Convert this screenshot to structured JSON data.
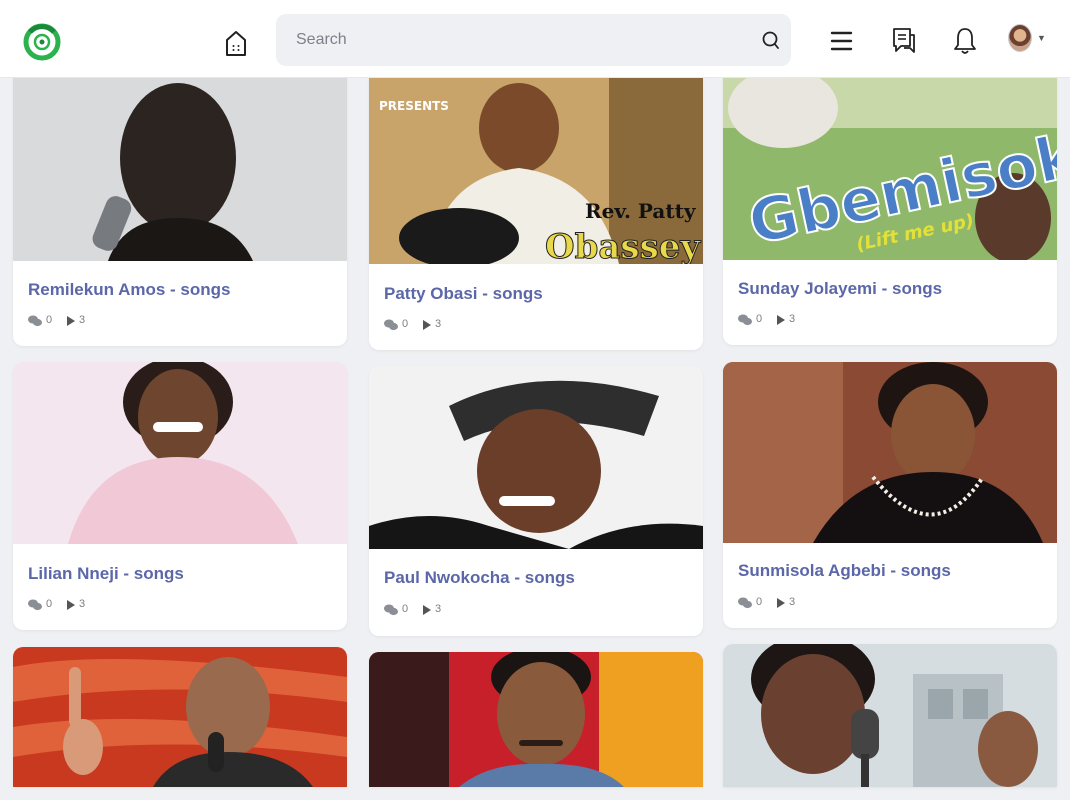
{
  "search": {
    "placeholder": "Search"
  },
  "header_icons": [
    "home-icon",
    "search-icon",
    "menu-icon",
    "messages-icon",
    "bell-icon",
    "user-avatar"
  ],
  "brand_color": "#2bb24c",
  "title_color": "#5b67a8",
  "cards": [
    {
      "title": "Remilekun Amos - songs",
      "comments": "0",
      "plays": "3"
    },
    {
      "title": "Patty Obasi - songs",
      "comments": "0",
      "plays": "3",
      "cover_text": [
        "PRESENTS",
        "Rev. Patty",
        "Obassey"
      ]
    },
    {
      "title": "Sunday Jolayemi - songs",
      "comments": "0",
      "plays": "3",
      "cover_text": [
        "Gbemisoke",
        "(Lift me up)"
      ]
    },
    {
      "title": "Lilian Nneji - songs",
      "comments": "0",
      "plays": "3"
    },
    {
      "title": "Paul Nwokocha - songs",
      "comments": "0",
      "plays": "3"
    },
    {
      "title": "Sunmisola Agbebi - songs",
      "comments": "0",
      "plays": "3"
    },
    {
      "title": "",
      "comments": "",
      "plays": ""
    },
    {
      "title": "",
      "comments": "",
      "plays": ""
    },
    {
      "title": "",
      "comments": "",
      "plays": ""
    }
  ]
}
